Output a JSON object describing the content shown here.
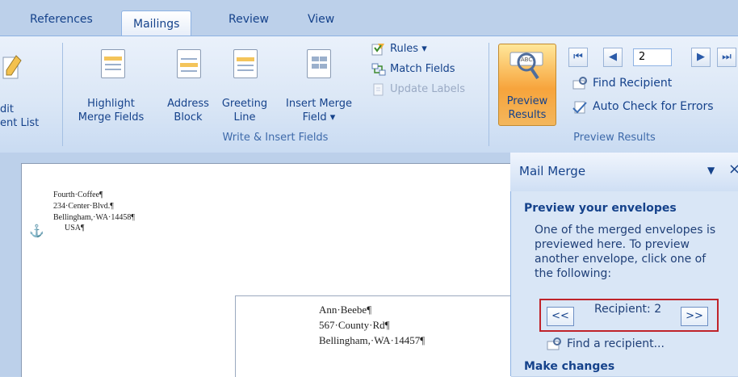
{
  "tabs": [
    {
      "label": "References",
      "active": false
    },
    {
      "label": "Mailings",
      "active": true
    },
    {
      "label": "Review",
      "active": false
    },
    {
      "label": "View",
      "active": false
    }
  ],
  "ribbon": {
    "edit_list": {
      "line1": "dit",
      "line2": "ent List"
    },
    "highlight": {
      "line1": "Highlight",
      "line2": "Merge Fields"
    },
    "address": {
      "line1": "Address",
      "line2": "Block"
    },
    "greeting": {
      "line1": "Greeting",
      "line2": "Line"
    },
    "insert_merge": {
      "line1": "Insert Merge",
      "line2": "Field"
    },
    "rules": "Rules",
    "match_fields": "Match Fields",
    "update_labels": "Update Labels",
    "write_insert_group": "Write & Insert Fields",
    "preview_results": {
      "line1": "Preview",
      "line2": "Results"
    },
    "record_number": "2",
    "find_recipient": "Find Recipient",
    "auto_check": "Auto Check for Errors",
    "preview_group": "Preview Results",
    "accent_color": "#f7a43c"
  },
  "document": {
    "return_address": [
      "Fourth·Coffee¶",
      "234·Center·Blvd.¶",
      "Bellingham,·WA·14458¶",
      "USA¶"
    ],
    "anchor_symbol": "⚓",
    "recipient_address": [
      "Ann·Beebe¶",
      "567·County·Rd¶",
      "Bellingham,·WA·14457¶"
    ]
  },
  "task_pane": {
    "title": "Mail Merge",
    "close_symbol": "×",
    "menu_arrow": "▼",
    "heading": "Preview your envelopes",
    "description": [
      "One of the merged envelopes is",
      "previewed here. To preview",
      "another envelope, click one of",
      "the following:"
    ],
    "prev_label": "<<",
    "recipient_text": "Recipient: 2",
    "next_label": ">>",
    "find_recipient_link": "Find a recipient...",
    "section2": "Make changes",
    "highlight_color": "#c0232a"
  }
}
